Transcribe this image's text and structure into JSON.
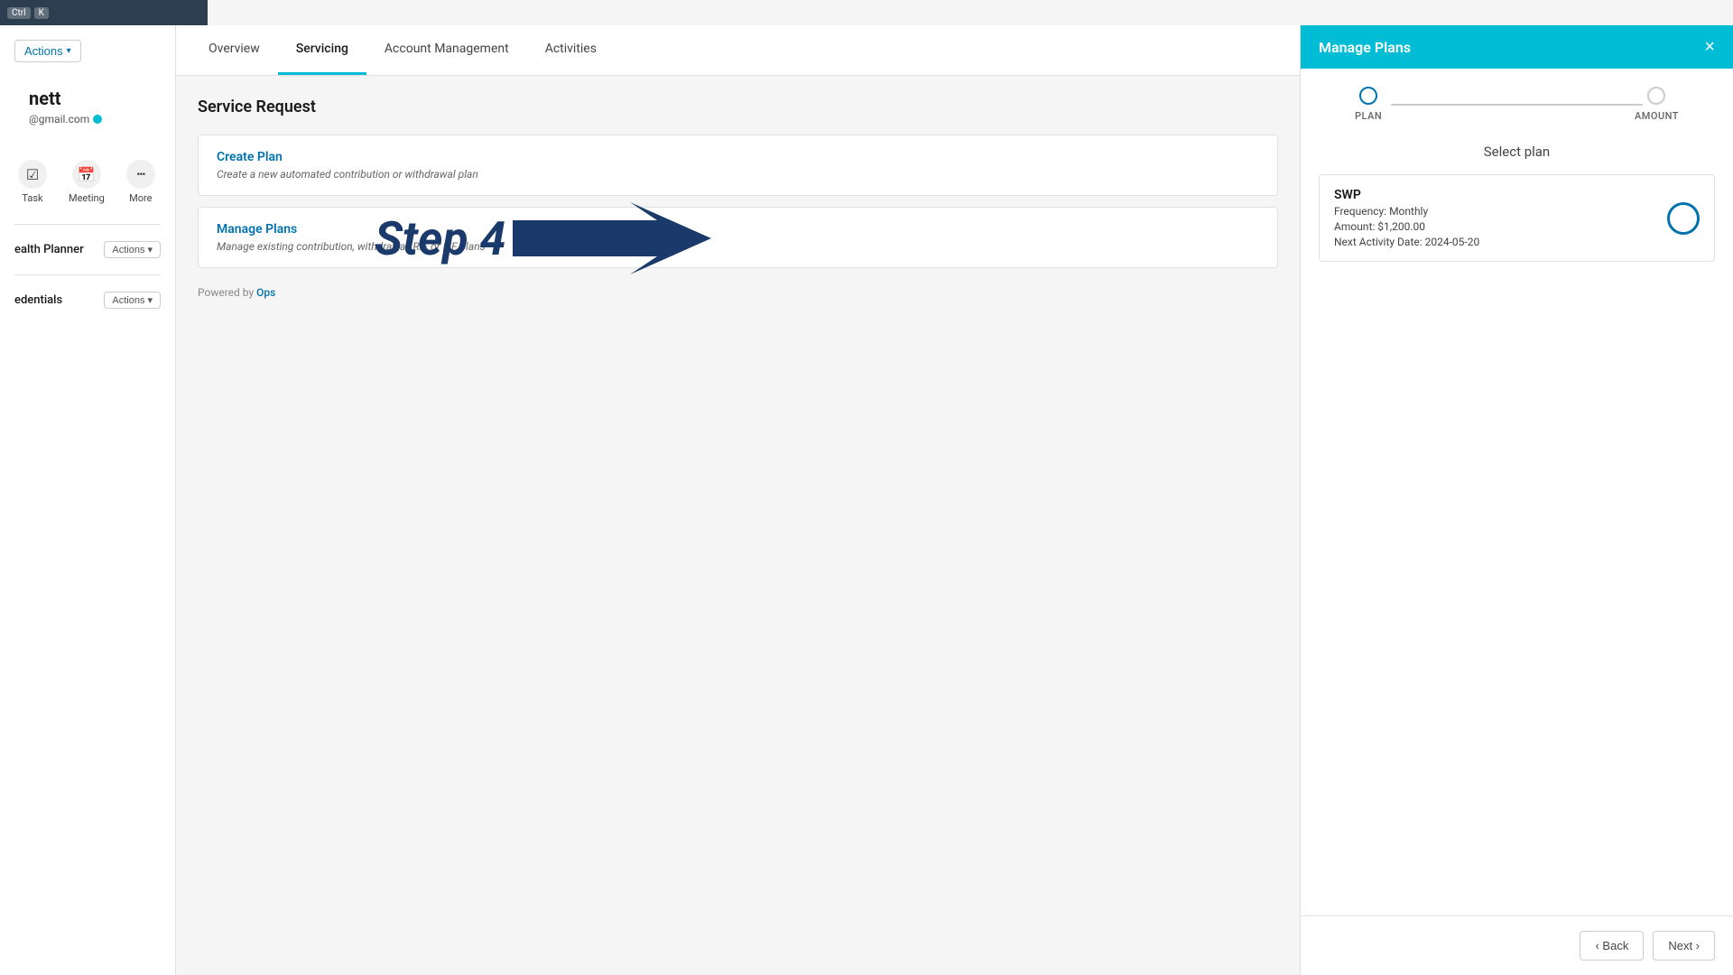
{
  "topbar": {
    "shortcuts": [
      "Ctrl",
      "K"
    ]
  },
  "sidebar": {
    "name": "nett",
    "email": "@gmail.com",
    "actions_label": "Actions",
    "actions_arrow": "▾",
    "icons": [
      {
        "label": "Task",
        "icon": "☑"
      },
      {
        "label": "Meeting",
        "icon": "📅"
      },
      {
        "label": "More",
        "icon": "•••"
      }
    ],
    "sections": [
      {
        "label": "ealth Planner",
        "actions_label": "Actions",
        "actions_arrow": "▾"
      },
      {
        "label": "edentials",
        "actions_label": "Actions",
        "actions_arrow": "▾"
      }
    ]
  },
  "tabs": [
    {
      "label": "Overview",
      "active": false
    },
    {
      "label": "Servicing",
      "active": true
    },
    {
      "label": "Account Management",
      "active": false
    },
    {
      "label": "Activities",
      "active": false
    }
  ],
  "service_request": {
    "title": "Service Request",
    "cards": [
      {
        "title": "Create Plan",
        "description": "Create a new automated contribution or withdrawal plan"
      },
      {
        "title": "Manage Plans",
        "description": "Manage existing contribution, withdrawal, RIF or LIF plans"
      }
    ],
    "powered_by": "Powered by",
    "powered_by_link": "Ops"
  },
  "step4": {
    "label": "Step 4"
  },
  "manage_plans_panel": {
    "title": "Manage Plans",
    "close_icon": "×",
    "steps": [
      {
        "label": "PLAN",
        "active": true
      },
      {
        "label": "AMOUNT",
        "active": false
      }
    ],
    "select_plan_title": "Select plan",
    "plan": {
      "name": "SWP",
      "frequency": "Frequency: Monthly",
      "amount": "Amount: $1,200.00",
      "next_activity": "Next Activity Date: 2024-05-20"
    },
    "footer": {
      "back_label": "‹ Back",
      "next_label": "Next ›"
    }
  }
}
